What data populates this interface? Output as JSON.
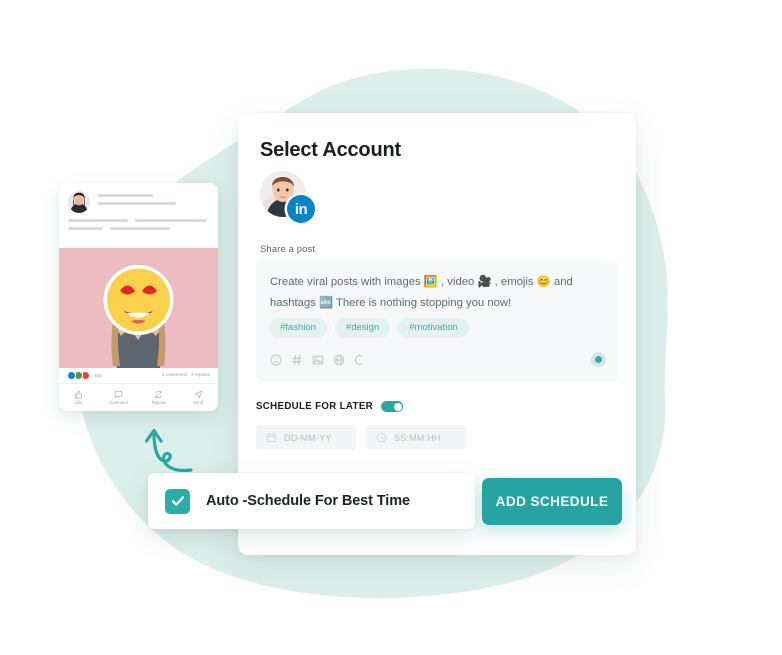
{
  "theme": {
    "accent": "#27a3a2",
    "accent_light": "#e3f2ee",
    "blob": "#dbeee9",
    "linkedin_blue": "#0a84c8",
    "image_bg": "#edbcc0"
  },
  "main_card": {
    "title": "Select Account",
    "account": {
      "avatar_name": "user-avatar",
      "network_badge": "in",
      "network_name": "linkedin"
    },
    "share_label": "Share a post",
    "composer": {
      "text_line_1": "Create viral posts with images 🖼️ , video 🎥 , emojis 😊 and",
      "text_line_2": "hashtags 🔤 There is nothing stopping you now!",
      "hashtags": [
        "#fashion",
        "#design",
        "#motivation"
      ],
      "tools": [
        "emoji-icon",
        "hashtag-icon",
        "image-icon",
        "globe-icon",
        "link-icon"
      ],
      "visibility_icon": "globe-visibility-icon"
    },
    "schedule": {
      "label": "SCHEDULE FOR LATER",
      "toggle_on": true,
      "date_placeholder": "DD-MM-YY",
      "time_placeholder": "SS:MM:HH",
      "date_icon": "calendar-icon",
      "time_icon": "clock-icon"
    }
  },
  "auto_schedule": {
    "label": "Auto -Schedule For Best Time",
    "checked": true
  },
  "add_schedule_button": {
    "label": "ADD SCHEDULE"
  },
  "preview": {
    "reactions_count": "466",
    "meta": "4 comments  ·  3 reposts",
    "actions": [
      {
        "label": "Like",
        "icon": "thumbs-up-icon"
      },
      {
        "label": "Comment",
        "icon": "comment-icon"
      },
      {
        "label": "Repost",
        "icon": "repost-icon"
      },
      {
        "label": "Send",
        "icon": "send-icon"
      }
    ]
  }
}
